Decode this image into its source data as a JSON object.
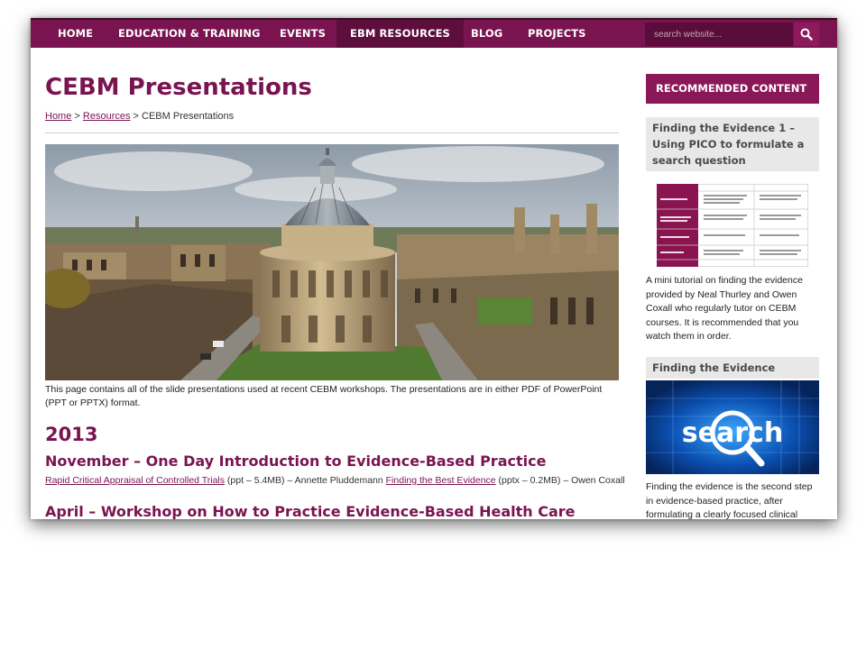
{
  "nav": {
    "items": [
      {
        "label": "HOME",
        "active": false
      },
      {
        "label": "EDUCATION & TRAINING",
        "active": false
      },
      {
        "label": "EVENTS",
        "active": false
      },
      {
        "label": "EBM RESOURCES",
        "active": true
      },
      {
        "label": "BLOG",
        "active": false
      },
      {
        "label": "PROJECTS",
        "active": false
      }
    ],
    "search_placeholder": "search website...",
    "search_icon": "search-icon"
  },
  "page": {
    "title": "CEBM Presentations",
    "breadcrumb": {
      "home": "Home",
      "sep1": " > ",
      "resources": "Resources",
      "sep2": " > ",
      "current": "CEBM Presentations"
    },
    "intro": "This page contains all of the slide presentations used at recent CEBM workshops. The presentations are in either PDF of PowerPoint (PPT or PPTX) format.",
    "year": "2013",
    "sections": [
      {
        "heading": "November – One Day Introduction to Evidence-Based Practice",
        "links": [
          {
            "text": "Rapid Critical Appraisal of Controlled Trials",
            "meta": " (ppt – 5.4MB) – Annette Pluddemann "
          },
          {
            "text": "Finding the Best Evidence",
            "meta": " (pptx – 0.2MB) – Owen Coxall"
          }
        ]
      },
      {
        "heading": "April – Workshop on How to Practice Evidence-Based Health Care"
      }
    ]
  },
  "sidebar": {
    "heading": "RECOMMENDED CONTENT",
    "cards": [
      {
        "title": "Finding the Evidence 1 – Using PICO to formulate a search question",
        "description": "A mini tutorial on finding the evidence provided by Neal Thurley and Owen Coxall who regularly tutor on CEBM courses. It is recommended that you watch them in order."
      },
      {
        "title": "Finding the Evidence",
        "thumb_text": "search",
        "description": "Finding the evidence is the second step in evidence-based practice, after formulating a clearly focused clinical"
      }
    ]
  },
  "colors": {
    "brand": "#7a1450",
    "nav_active": "#5d0e3c",
    "sidebar_head": "#8a1858"
  }
}
